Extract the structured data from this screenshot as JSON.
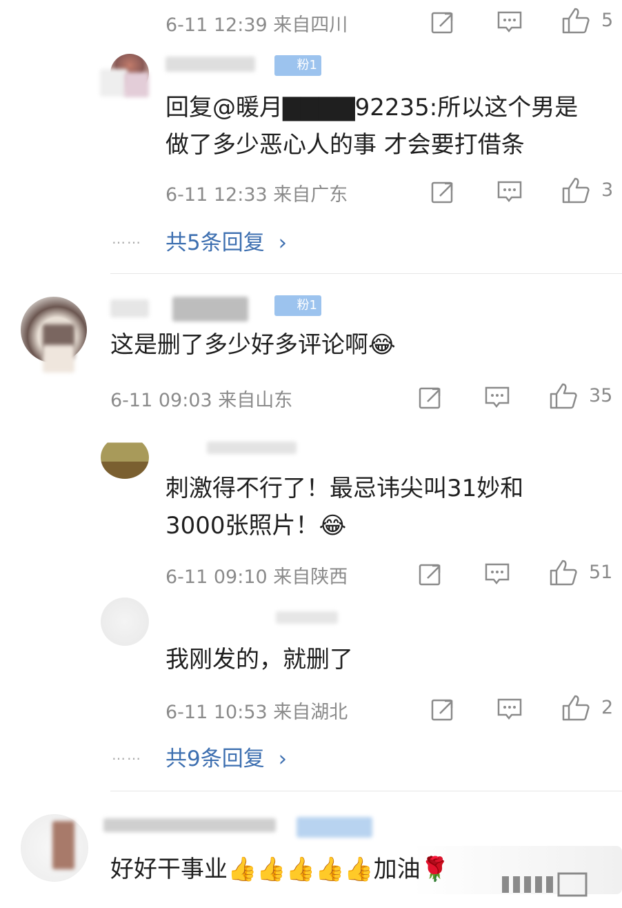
{
  "comments": [
    {
      "id": "r0",
      "meta": "6-11 12:39 来自四川",
      "likes": "5"
    },
    {
      "id": "r1",
      "badge": "粉1",
      "text_line1": "回复@暖月▇▇▇▇92235:所以这个男是",
      "text_line2": "做了多少恶心人的事 才会要打借条",
      "meta": "6-11 12:33 来自广东",
      "likes": "3",
      "replies_link": "共5条回复",
      "replies_dots": "……"
    },
    {
      "id": "c2",
      "badge": "粉1",
      "text": "这是删了多少好多评论啊😂",
      "meta": "6-11 09:03 来自山东",
      "likes": "35"
    },
    {
      "id": "r3",
      "text_line1": "刺激得不行了！最忌讳尖叫31妙和",
      "text_line2": "3000张照片！😂",
      "meta": "6-11 09:10 来自陕西",
      "likes": "51"
    },
    {
      "id": "r4",
      "text": "我刚发的，就删了",
      "meta": "6-11 10:53 来自湖北",
      "likes": "2",
      "replies_link": "共9条回复",
      "replies_dots": "……"
    },
    {
      "id": "c5",
      "text": "好好干事业👍👍👍👍👍加油🌹"
    }
  ],
  "colors": {
    "link": "#3d6fb0",
    "meta": "#8a8a8a",
    "badge": "#9cc3ee",
    "divider": "#e6e6e6"
  }
}
